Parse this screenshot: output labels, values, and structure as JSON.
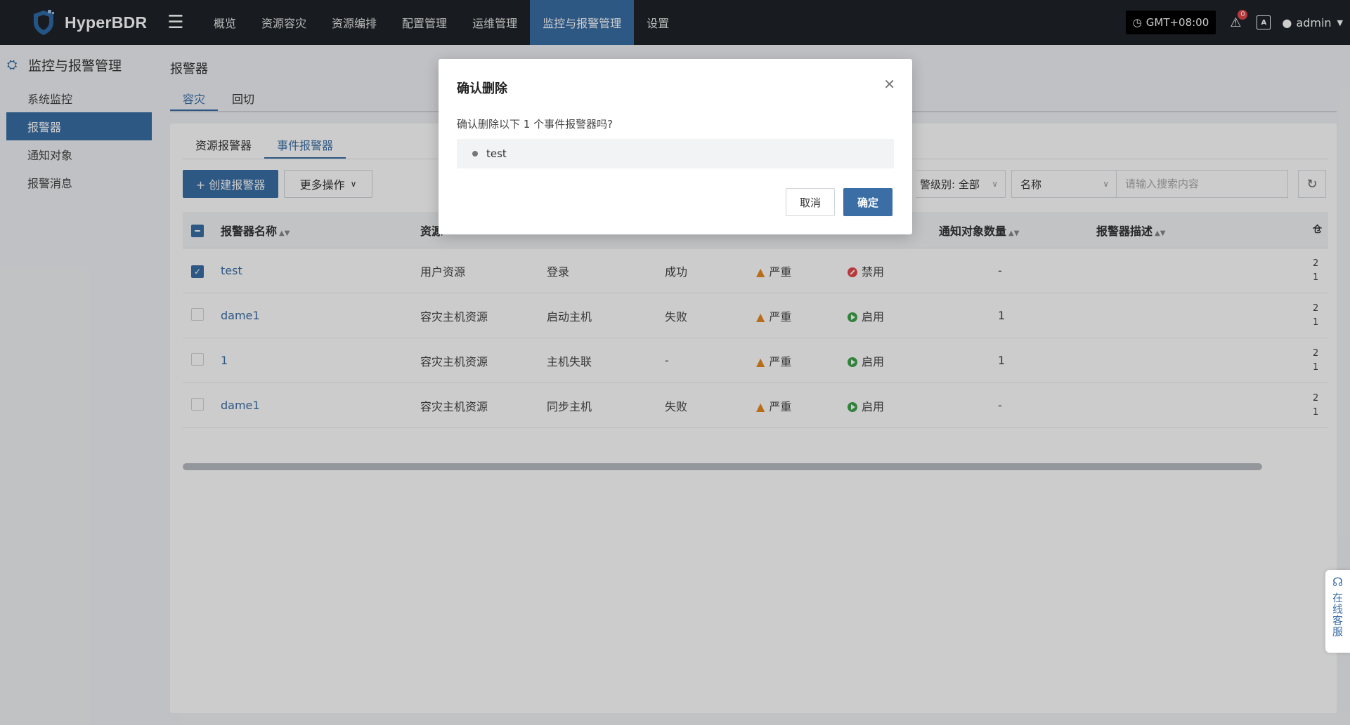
{
  "topbar": {
    "logo_text": "HyperBDR",
    "nav": [
      "概览",
      "资源容灾",
      "资源编排",
      "配置管理",
      "运维管理",
      "监控与报警管理",
      "设置"
    ],
    "active_nav_index": 5,
    "timezone": "GMT+08:00",
    "notification_count": "0",
    "lang_label": "A",
    "user": "admin",
    "accent_color": "#3a6ea5"
  },
  "sidebar": {
    "title": "监控与报警管理",
    "items": [
      {
        "label": "系统监控"
      },
      {
        "label": "报警器"
      },
      {
        "label": "通知对象"
      },
      {
        "label": "报警消息"
      }
    ],
    "active_index": 1
  },
  "page": {
    "title": "报警器",
    "tabs": [
      "容灾",
      "回切"
    ],
    "subtabs": [
      "资源报警器",
      "事件报警器"
    ]
  },
  "toolbar": {
    "create_label": "+ 创建报警器",
    "more_label": "更多操作",
    "level_filter": "警级别:  全部",
    "name_filter": "名称",
    "search_placeholder": "请输入搜索内容"
  },
  "table": {
    "headers": {
      "name": "报警器名称",
      "type": "资源",
      "count": "通知对象数量",
      "desc": "报警器描述",
      "more": "仓"
    },
    "rows": [
      {
        "name": "test",
        "type": "用户资源",
        "event": "登录",
        "result": "成功",
        "level": "严重",
        "status": "禁用",
        "enabled": false,
        "count": "-",
        "checked": true,
        "more": "2\n1"
      },
      {
        "name": "dame1",
        "type": "容灾主机资源",
        "event": "启动主机",
        "result": "失败",
        "level": "严重",
        "status": "启用",
        "enabled": true,
        "count": "1",
        "checked": false,
        "more": "2\n1"
      },
      {
        "name": "1",
        "type": "容灾主机资源",
        "event": "主机失联",
        "result": "-",
        "level": "严重",
        "status": "启用",
        "enabled": true,
        "count": "1",
        "checked": false,
        "more": "2\n1"
      },
      {
        "name": "dame1",
        "type": "容灾主机资源",
        "event": "同步主机",
        "result": "失败",
        "level": "严重",
        "status": "启用",
        "enabled": true,
        "count": "-",
        "checked": false,
        "more": "2\n1"
      }
    ]
  },
  "modal": {
    "title": "确认删除",
    "message": "确认删除以下 1 个事件报警器吗?",
    "items": [
      "test"
    ],
    "cancel_label": "取消",
    "ok_label": "确定"
  },
  "support": {
    "label": "在线客服"
  }
}
